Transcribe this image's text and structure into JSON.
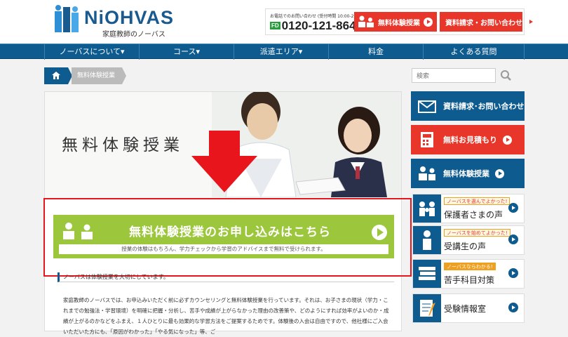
{
  "header": {
    "logo_text": "NiOHVAS",
    "logo_sub": "家庭教師のノーバス",
    "phone_caption": "お電話でのお問い合わせ (受付時間 10:00-21:00)",
    "phone_badge": "FD",
    "phone_number": "0120-121-864",
    "btn_trial": "無料体験授業",
    "btn_contact": "資料請求・お問い合わせ"
  },
  "nav": {
    "items": [
      {
        "label": "ノーバスについて▾"
      },
      {
        "label": "コース▾"
      },
      {
        "label": "派遣エリア▾"
      },
      {
        "label": "料金"
      },
      {
        "label": "よくある質問"
      }
    ]
  },
  "breadcrumb": {
    "current": "無料体験授業"
  },
  "search": {
    "placeholder": "検索"
  },
  "hero": {
    "title": "無料体験授業"
  },
  "cta": {
    "title": "無料体験授業のお申し込みはこちら",
    "subtitle": "授業の体験はもちろん、学力チェックから学習のアドバイスまで無料で受けられます。"
  },
  "section": {
    "heading": "ノーバスは体験授業を大切にしています。"
  },
  "body": {
    "text": "家庭教師のノーバスでは、お申込みいただく前に必ずカウンセリングと無料体験授業を行っています。それは、お子さまの現状（学力・これまでの勉強法・学習環境）を明確に把握・分析し、苦手や成績が上がらなかった理由の改善策や、どのようにすれば効率がよいのか・成績が上がるのかなどをふまえ、１人ひとりに最も効果的な学習方法をご提案するためです。体験後の入会は自由ですので、他社様にご入会いただいた方にも、「原因がわかった」「やる気になった」等、ご"
  },
  "sidebar": {
    "btn_contact": "資料請求･お問い合わせ",
    "btn_estimate": "無料お見積もり",
    "btn_trial": "無料体験授業",
    "voices": [
      {
        "tag": "ノーバスを選んでよかった!",
        "label": "保護者さまの声"
      },
      {
        "tag": "ノーバスを始めてよかった!",
        "label": "受講生の声"
      },
      {
        "tag": "ノーバスならわかる!",
        "label": "苦手科目対策"
      },
      {
        "tag": "",
        "label": "受験情報室"
      }
    ]
  },
  "colors": {
    "brand_blue": "#0e5b8f",
    "accent_red": "#e8362a",
    "cta_green": "#9cc63b",
    "highlight_red": "#e8161c"
  }
}
